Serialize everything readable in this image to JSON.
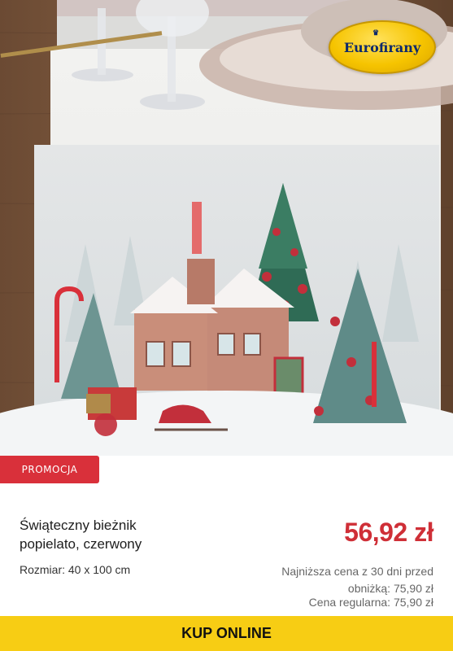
{
  "brand": {
    "logo_text": "Eurofirany"
  },
  "badge": {
    "label": "PROMOCJA"
  },
  "product": {
    "title_line1": "Świąteczny bieżnik",
    "title_line2": "popielato, czerwony",
    "price": "56,92 zł",
    "size": "Rozmiar: 40 x 100 cm",
    "lowest_price_note": "Najniższa cena z 30 dni przed obniżką: 75,90 zł",
    "regular_price": "Cena regularna: 75,90 zł"
  },
  "cta": {
    "label": "KUP ONLINE"
  },
  "colors": {
    "promo": "#d9303a",
    "price": "#cf2f37",
    "cta": "#f7cd14",
    "logo": "#f6c400"
  },
  "icons": {
    "logo": "eurofirany-logo-icon"
  }
}
